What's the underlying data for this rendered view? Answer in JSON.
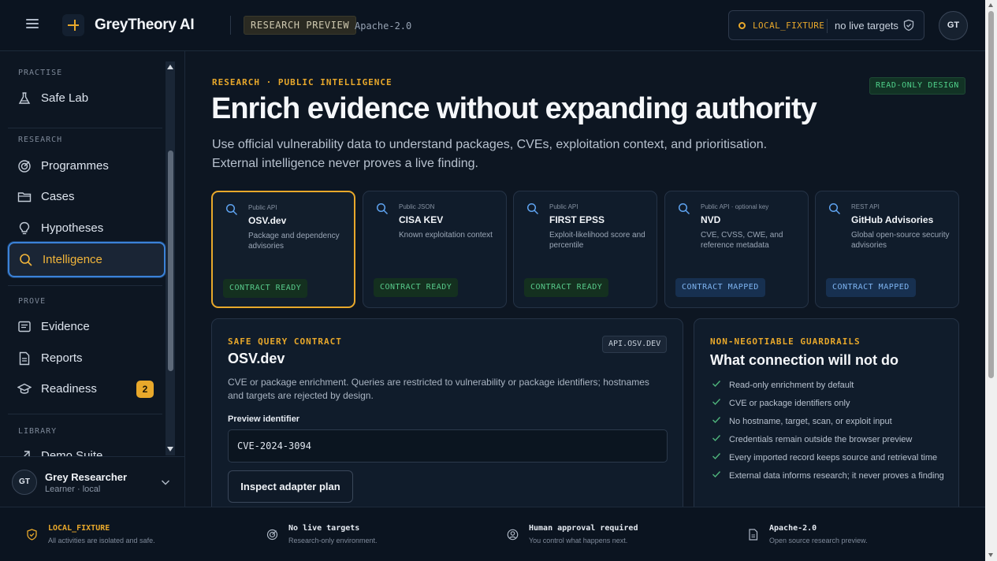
{
  "header": {
    "brand": "GreyTheory AI",
    "preview_badge": "RESEARCH PREVIEW",
    "license": "Apache-2.0",
    "env_label": "LOCAL_FIXTURE",
    "env_text": "no live targets",
    "avatar_initials": "GT"
  },
  "sidebar": {
    "sections": {
      "practise": "PRACTISE",
      "research": "RESEARCH",
      "prove": "PROVE",
      "library": "LIBRARY"
    },
    "items": [
      {
        "label": "Safe Lab",
        "icon": "flask-icon"
      },
      {
        "label": "Programmes",
        "icon": "target-icon"
      },
      {
        "label": "Cases",
        "icon": "folder-icon"
      },
      {
        "label": "Hypotheses",
        "icon": "lightbulb-icon"
      },
      {
        "label": "Intelligence",
        "icon": "search-icon",
        "active": true
      },
      {
        "label": "Evidence",
        "icon": "evidence-icon"
      },
      {
        "label": "Reports",
        "icon": "document-icon"
      },
      {
        "label": "Readiness",
        "icon": "graduation-cap-icon",
        "badge": "2"
      },
      {
        "label": "Demo Suite",
        "icon": "expand-icon"
      }
    ],
    "user": {
      "initials": "GT",
      "name": "Grey Researcher",
      "role": "Learner · local"
    }
  },
  "main": {
    "eyebrow": "RESEARCH · PUBLIC INTELLIGENCE",
    "readonly_badge": "READ-ONLY DESIGN",
    "title": "Enrich evidence without expanding authority",
    "subtitle": "Use official vulnerability data to understand packages, CVEs, exploitation context, and prioritisation. External intelligence never proves a live finding.",
    "sources": [
      {
        "type": "Public API",
        "name": "OSV.dev",
        "desc": "Package and dependency advisories",
        "status": "CONTRACT READY",
        "status_kind": "ready",
        "selected": true
      },
      {
        "type": "Public JSON",
        "name": "CISA KEV",
        "desc": "Known exploitation context",
        "status": "CONTRACT READY",
        "status_kind": "ready"
      },
      {
        "type": "Public API",
        "name": "FIRST EPSS",
        "desc": "Exploit-likelihood score and percentile",
        "status": "CONTRACT READY",
        "status_kind": "ready"
      },
      {
        "type": "Public API · optional key",
        "name": "NVD",
        "desc": "CVE, CVSS, CWE, and reference metadata",
        "status": "CONTRACT MAPPED",
        "status_kind": "mapped"
      },
      {
        "type": "REST API",
        "name": "GitHub Advisories",
        "desc": "Global open-source security advisories",
        "status": "CONTRACT MAPPED",
        "status_kind": "mapped"
      }
    ],
    "contract": {
      "eyebrow": "SAFE QUERY CONTRACT",
      "title": "OSV.dev",
      "api_chip": "API.OSV.DEV",
      "desc": "CVE or package enrichment. Queries are restricted to vulnerability or package identifiers; hostnames and targets are rejected by design.",
      "field_label": "Preview identifier",
      "field_value": "CVE-2024-3094",
      "button": "Inspect adapter plan"
    },
    "guardrails": {
      "eyebrow": "NON-NEGOTIABLE GUARDRAILS",
      "title": "What connection will not do",
      "items": [
        "Read-only enrichment by default",
        "CVE or package identifiers only",
        "No hostname, target, scan, or exploit input",
        "Credentials remain outside the browser preview",
        "Every imported record keeps source and retrieval time",
        "External data informs research; it never proves a finding"
      ]
    }
  },
  "footer": [
    {
      "title": "LOCAL_FIXTURE",
      "sub": "All activities are isolated and safe.",
      "icon": "shield-icon"
    },
    {
      "title": "No live targets",
      "sub": "Research-only environment.",
      "icon": "target-icon"
    },
    {
      "title": "Human approval required",
      "sub": "You control what happens next.",
      "icon": "user-circle-icon"
    },
    {
      "title": "Apache-2.0",
      "sub": "Open source research preview.",
      "icon": "document-icon"
    }
  ],
  "colors": {
    "accent": "#e8a82b",
    "active_border": "#3b82d8",
    "ready": "#57c98a",
    "mapped": "#7db3f0",
    "background": "#0d1622"
  }
}
